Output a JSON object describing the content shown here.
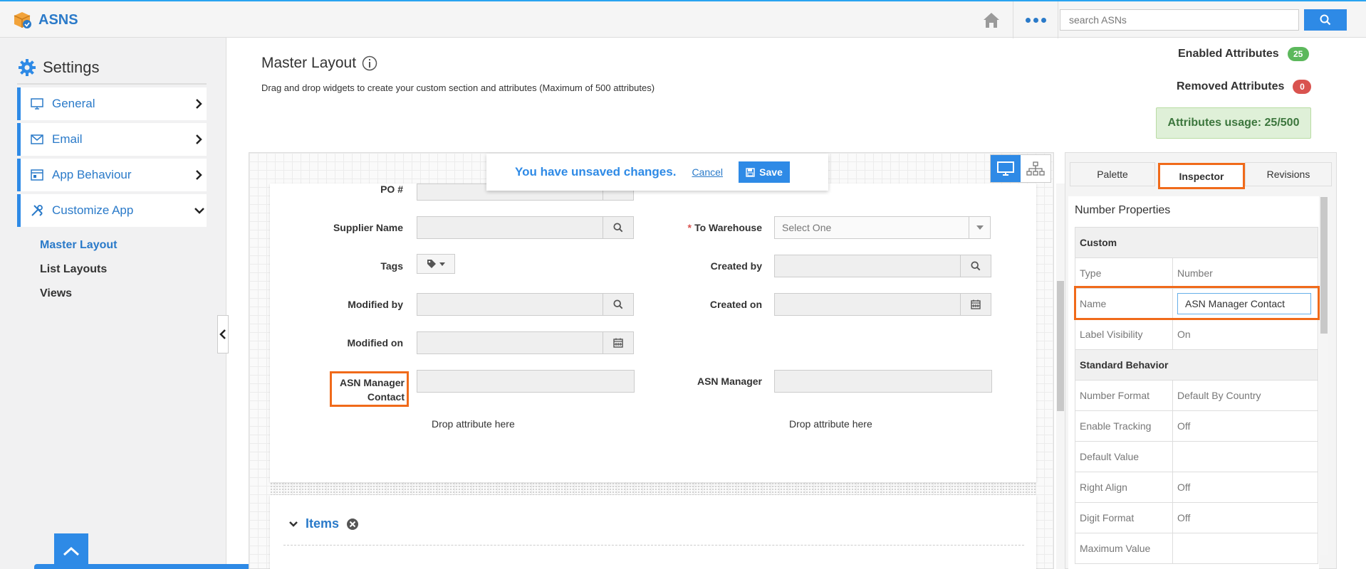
{
  "app": {
    "title": "ASNS"
  },
  "search": {
    "placeholder": "search ASNs"
  },
  "sidebar": {
    "title": "Settings",
    "items": [
      {
        "label": "General"
      },
      {
        "label": "Email"
      },
      {
        "label": "App Behaviour"
      },
      {
        "label": "Customize App"
      }
    ],
    "subitems": [
      {
        "label": "Master Layout"
      },
      {
        "label": "List Layouts"
      },
      {
        "label": "Views"
      }
    ]
  },
  "header": {
    "title": "Master Layout",
    "description": "Drag and drop widgets to create your custom section and attributes (Maximum of 500 attributes)",
    "enabled_label": "Enabled Attributes",
    "enabled_count": "25",
    "removed_label": "Removed Attributes",
    "removed_count": "0",
    "usage": "Attributes usage: 25/500"
  },
  "notice": {
    "message": "You have unsaved changes.",
    "cancel": "Cancel",
    "save": "Save"
  },
  "form": {
    "po": "PO #",
    "supplier_name": "Supplier Name",
    "tags": "Tags",
    "modified_by": "Modified by",
    "modified_on": "Modified on",
    "asn_manager_contact_1": "ASN Manager",
    "asn_manager_contact_2": "Contact",
    "required_mark": "*",
    "to_warehouse": "To Warehouse",
    "to_warehouse_value": "Select One",
    "created_by": "Created by",
    "created_on": "Created on",
    "asn_manager": "ASN Manager",
    "drop_text": "Drop attribute here"
  },
  "items_section": {
    "title": "Items"
  },
  "inspector": {
    "tabs": [
      "Palette",
      "Inspector",
      "Revisions"
    ],
    "title": "Number Properties",
    "sections": {
      "custom": "Custom",
      "standard": "Standard Behavior"
    },
    "rows": {
      "type": {
        "label": "Type",
        "value": "Number"
      },
      "name": {
        "label": "Name",
        "value": "ASN Manager Contact"
      },
      "label_visibility": {
        "label": "Label Visibility",
        "value": "On"
      },
      "number_format": {
        "label": "Number Format",
        "value": "Default By Country"
      },
      "enable_tracking": {
        "label": "Enable Tracking",
        "value": "Off"
      },
      "default_value": {
        "label": "Default Value",
        "value": ""
      },
      "right_align": {
        "label": "Right Align",
        "value": "Off"
      },
      "digit_format": {
        "label": "Digit Format",
        "value": "Off"
      },
      "maximum_value": {
        "label": "Maximum Value",
        "value": ""
      }
    }
  },
  "colors": {
    "accent": "#2e8ae6",
    "highlight": "#f06a1a",
    "success": "#5cb85c",
    "danger": "#d9534f"
  },
  "icons": [
    "logo-box-icon",
    "home-icon",
    "more-dots-icon",
    "search-icon",
    "gear-icon",
    "monitor-icon",
    "envelope-icon",
    "app-window-icon",
    "tools-icon",
    "chevron-right-icon",
    "chevron-down-icon",
    "chevron-left-icon",
    "chevron-up-icon",
    "info-icon",
    "save-icon",
    "desktop-view-icon",
    "hierarchy-view-icon",
    "tag-icon",
    "calendar-icon",
    "remove-icon"
  ]
}
